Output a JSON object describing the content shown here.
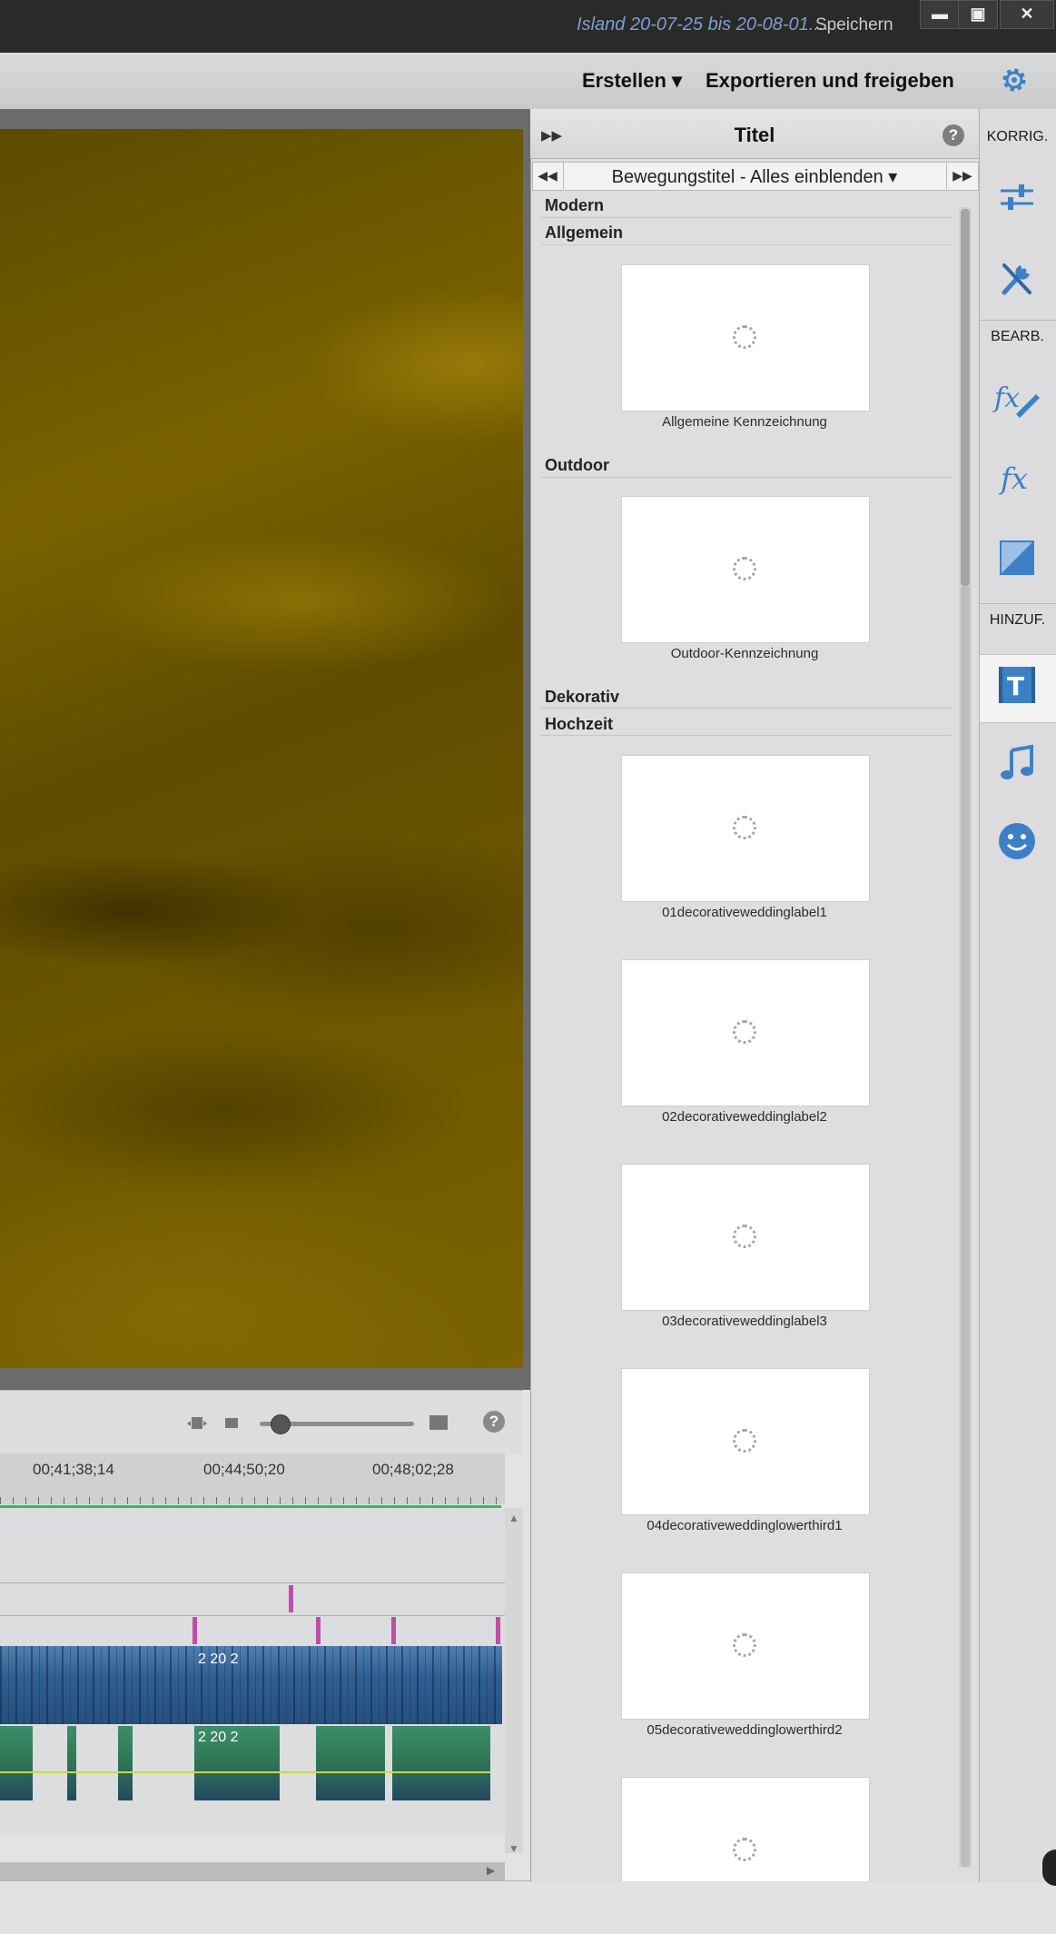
{
  "titlebar": {
    "document_title": "Island 20-07-25 bis 20-08-01....",
    "save_label": "Speichern",
    "minimize": "▬",
    "maximize": "▣",
    "close": "✕"
  },
  "menubar": {
    "create_label": "Erstellen ▾",
    "export_label": "Exportieren und freigeben"
  },
  "timeline": {
    "timecodes": [
      "00;41;38;14",
      "00;44;50;20",
      "00;48;02;28"
    ],
    "help": "?",
    "clip_number_text": "2 20 2",
    "clip_labels": [
      "2",
      "20",
      "2",
      "2",
      "2",
      "2",
      "2",
      "2"
    ]
  },
  "titles_panel": {
    "title": "Titel",
    "help": "?",
    "selector": {
      "value": "Bewegungstitel - Alles einblenden ▾",
      "prev": "◀◀",
      "next": "▶▶"
    },
    "categories": [
      {
        "name": "Modern"
      },
      {
        "name": "Allgemein"
      },
      {
        "name": "Outdoor"
      },
      {
        "name": "Dekorativ"
      },
      {
        "name": "Hochzeit"
      }
    ],
    "items": [
      {
        "label": "Allgemeine Kennzeichnung"
      },
      {
        "label": "Outdoor-Kennzeichnung"
      },
      {
        "label": "01decorativeweddinglabel1"
      },
      {
        "label": "02decorativeweddinglabel2"
      },
      {
        "label": "03decorativeweddinglabel3"
      },
      {
        "label": "04decorativeweddinglowerthird1"
      },
      {
        "label": "05decorativeweddinglowerthird2"
      }
    ]
  },
  "sidebar": {
    "section_korrig": "KORRIG.",
    "section_bearb": "BEARB.",
    "section_hinzuf": "HINZUF.",
    "icons": [
      "adjust-icon",
      "tools-icon",
      "fx-edit-icon",
      "fx-icon",
      "transition-icon",
      "titles-icon",
      "music-icon",
      "smiley-icon"
    ]
  },
  "colors": {
    "accent_blue": "#3d80c6",
    "title_text": "#7e9fd0",
    "timeline_green": "#27c24a",
    "marker_magenta": "#c04ea8"
  }
}
